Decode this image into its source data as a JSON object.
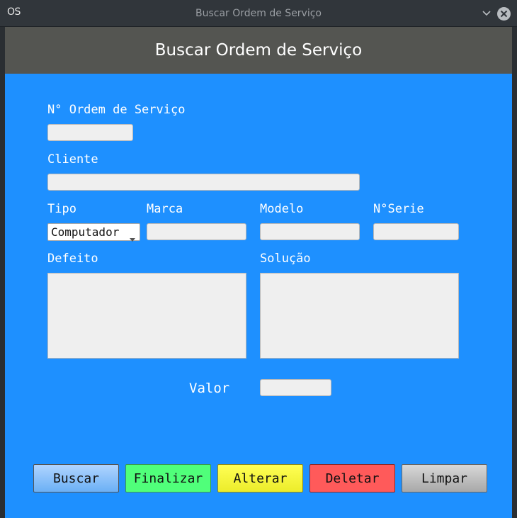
{
  "window": {
    "icon_text": "OS",
    "title": "Buscar Ordem de Serviço"
  },
  "header": {
    "title": "Buscar Ordem de Serviço"
  },
  "form": {
    "ordem_label": "N° Ordem de Serviço",
    "ordem_value": "",
    "cliente_label": "Cliente",
    "cliente_value": "",
    "tipo_label": "Tipo",
    "tipo_selected": "Computador",
    "marca_label": "Marca",
    "marca_value": "",
    "modelo_label": "Modelo",
    "modelo_value": "",
    "serie_label": "N°Serie",
    "serie_value": "",
    "defeito_label": "Defeito",
    "defeito_value": "",
    "solucao_label": "Solução",
    "solucao_value": "",
    "valor_label": "Valor",
    "valor_value": ""
  },
  "buttons": {
    "buscar": "Buscar",
    "finalizar": "Finalizar",
    "alterar": "Alterar",
    "deletar": "Deletar",
    "limpar": "Limpar"
  },
  "colors": {
    "background": "#1e90ff",
    "header": "#545551",
    "buscar": "#6bb0f5",
    "finalizar": "#50ff7a",
    "alterar": "#ffff55",
    "deletar": "#ff5a5a",
    "limpar": "#a8a8a8"
  },
  "icons": {
    "app": "os-logo-icon",
    "minimize": "chevron-down-icon",
    "close": "close-icon",
    "dropdown": "caret-down-icon"
  }
}
